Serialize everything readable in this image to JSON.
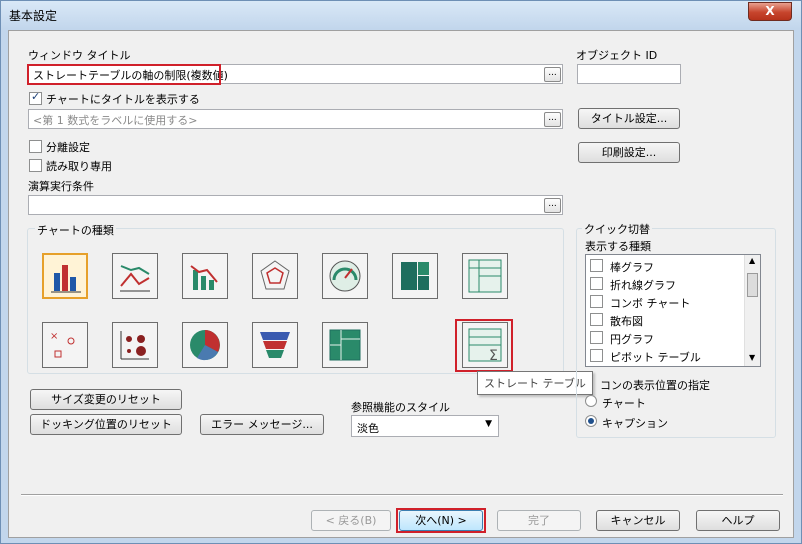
{
  "window": {
    "title": "基本設定",
    "close_label": "X"
  },
  "form": {
    "window_title_label": "ウィンドウ タイトル",
    "window_title_value": "ストレートテーブルの軸の制限(複数値)",
    "object_id_label": "オブジェクト ID",
    "object_id_value": "",
    "show_title_label": "チャートにタイトルを表示する",
    "show_title_checked": true,
    "title_placeholder": "<第 1 数式をラベルに使用する>",
    "title_settings_button": "タイトル設定...",
    "print_settings_button": "印刷設定...",
    "detach_label": "分離設定",
    "read_only_label": "読み取り専用",
    "calc_condition_label": "演算実行条件",
    "calc_condition_value": "",
    "ellipsis_label": "..."
  },
  "chart_types": {
    "group_title": "チャートの種類",
    "tiles": [
      {
        "name": "bar-chart",
        "color": "#2058a8"
      },
      {
        "name": "line-chart",
        "color": "#2a8a6a"
      },
      {
        "name": "combo-chart",
        "color": "#c03030"
      },
      {
        "name": "radar-chart",
        "color": "#c03030"
      },
      {
        "name": "gauge-chart",
        "color": "#2a8a6a"
      },
      {
        "name": "block-chart",
        "color": "#1e6e5e"
      },
      {
        "name": "pivot-table",
        "color": "#2a8a6a"
      },
      {
        "name": "scatter-chart",
        "color": "#c03030"
      },
      {
        "name": "grid-chart",
        "color": "#8a2020"
      },
      {
        "name": "pie-chart",
        "color": "#4a7ab0"
      },
      {
        "name": "funnel-chart",
        "color": "#2a8a6a"
      },
      {
        "name": "mekko-chart",
        "color": "#2a8a6a"
      },
      {
        "name": "straight-table",
        "color": "#2a8a6a"
      }
    ],
    "tooltip": "ストレート テーブル"
  },
  "quick_switch": {
    "group_title": "クイック切替",
    "list_label": "表示する種類",
    "items": [
      {
        "label": "棒グラフ",
        "checked": false
      },
      {
        "label": "折れ線グラフ",
        "checked": false
      },
      {
        "label": "コンボ チャート",
        "checked": false
      },
      {
        "label": "散布図",
        "checked": false
      },
      {
        "label": "円グラフ",
        "checked": false
      },
      {
        "label": "ピボット テーブル",
        "checked": false
      }
    ],
    "icon_position_label": "アイコンの表示位置の指定",
    "icon_position_visible": "コンの表示位置の指定",
    "radio_chart": "チャート",
    "radio_caption": "キャプション",
    "selected": "caption"
  },
  "actions": {
    "reset_size": "サイズ変更のリセット",
    "reset_docking": "ドッキング位置のリセット",
    "error_messages": "エラー メッセージ...",
    "ref_style_label": "参照機能のスタイル",
    "ref_style_value": "淡色"
  },
  "footer": {
    "back": "< 戻る(B)",
    "next": "次へ(N) >",
    "finish": "完了",
    "cancel": "キャンセル",
    "help": "ヘルプ"
  }
}
